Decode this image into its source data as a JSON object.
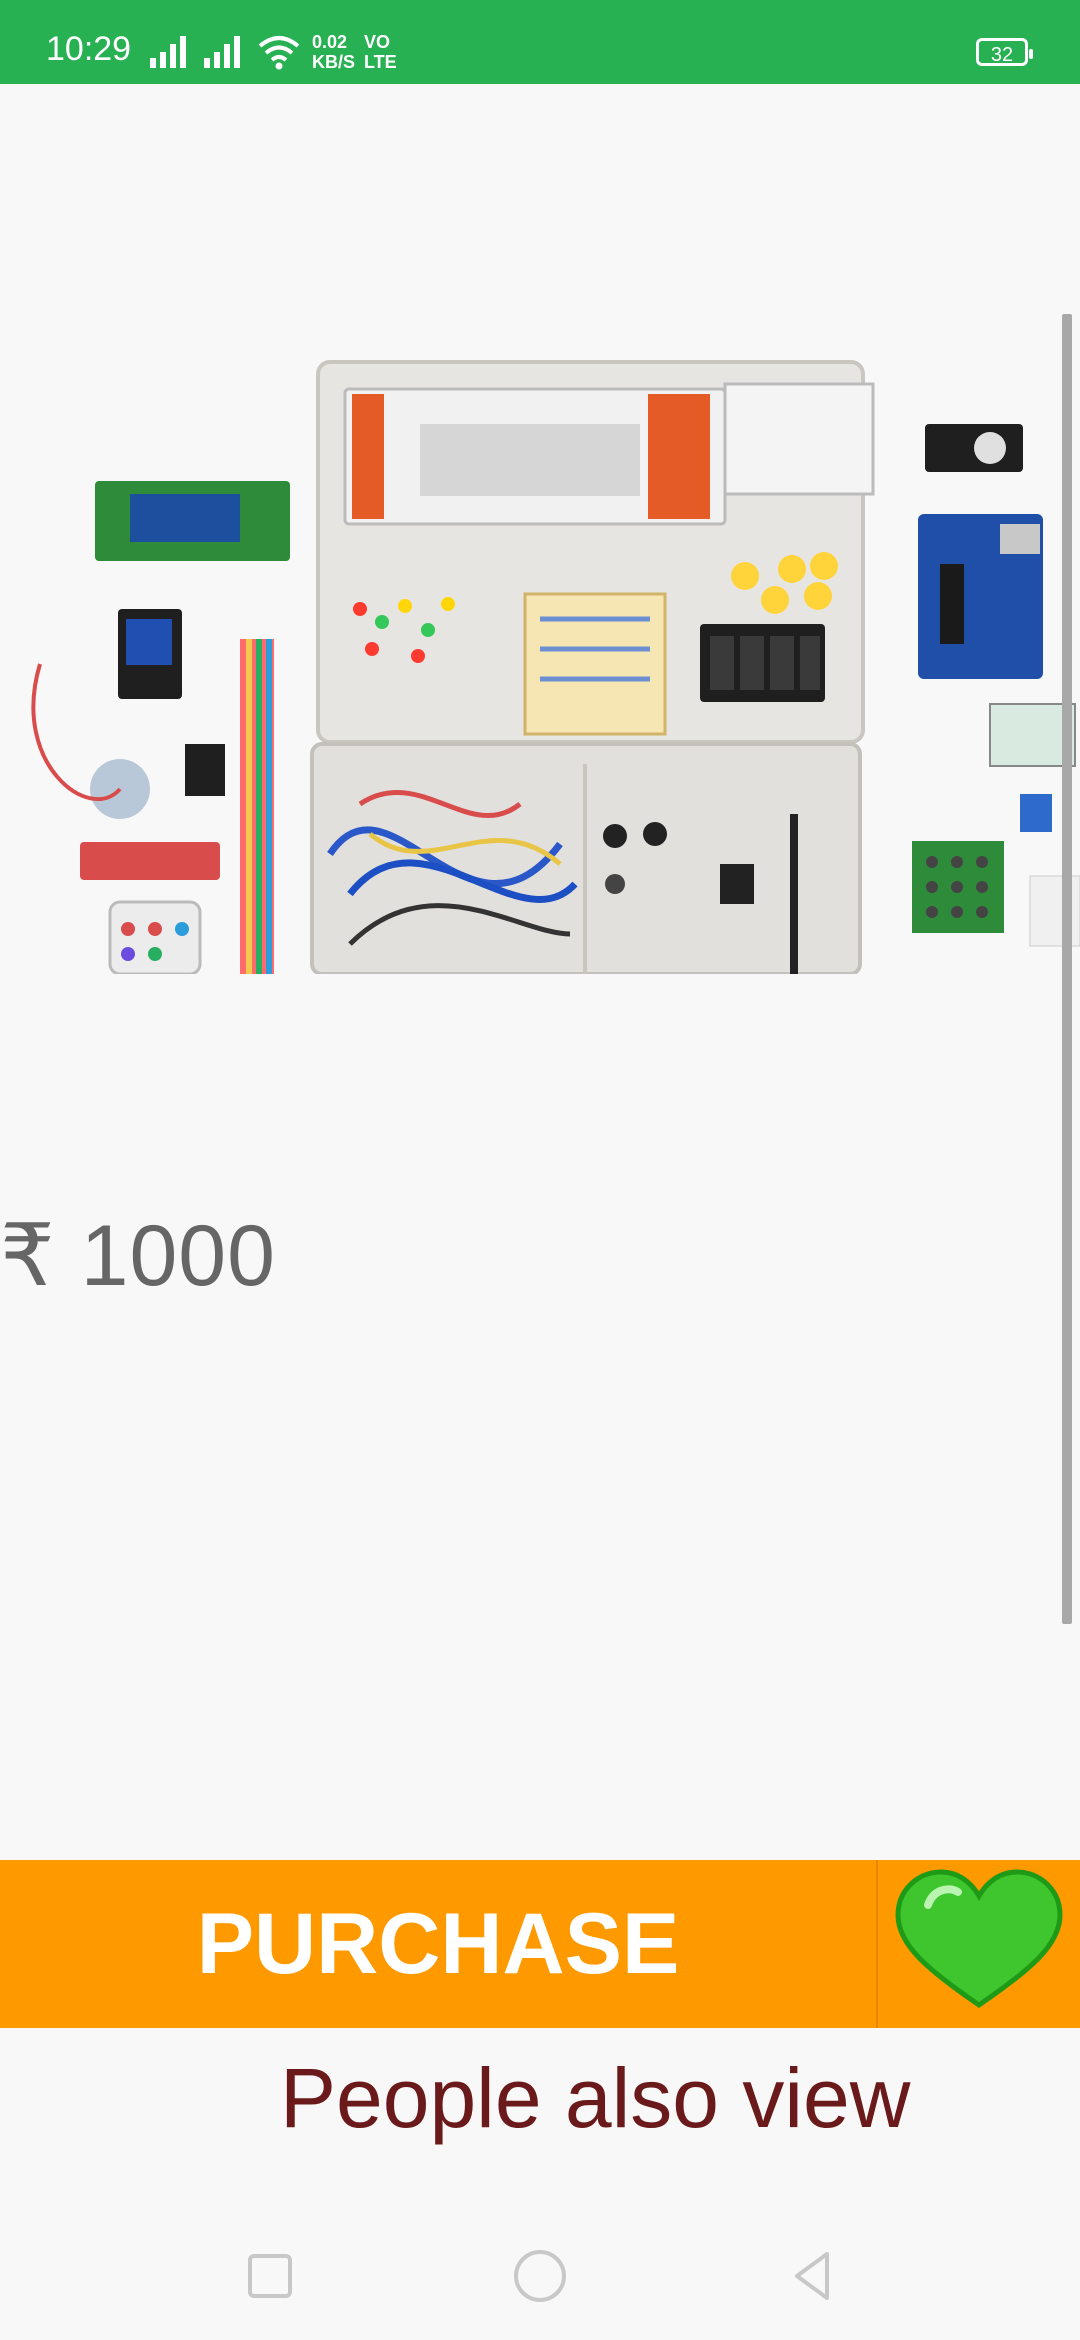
{
  "status_bar": {
    "time": "10:29",
    "net_speed": "0.02",
    "net_unit": "KB/S",
    "volte_top": "VO",
    "volte_bottom": "LTE",
    "battery": "32",
    "color": "#27b153"
  },
  "product": {
    "price": "₹ 1000"
  },
  "actions": {
    "purchase_label": "PURCHASE",
    "favorite_icon": "green-heart-icon",
    "bar_color": "#ff9900"
  },
  "section": {
    "people_also_view": "People also view"
  },
  "nav": {
    "recent_icon": "square-icon",
    "home_icon": "circle-icon",
    "back_icon": "triangle-back-icon"
  }
}
